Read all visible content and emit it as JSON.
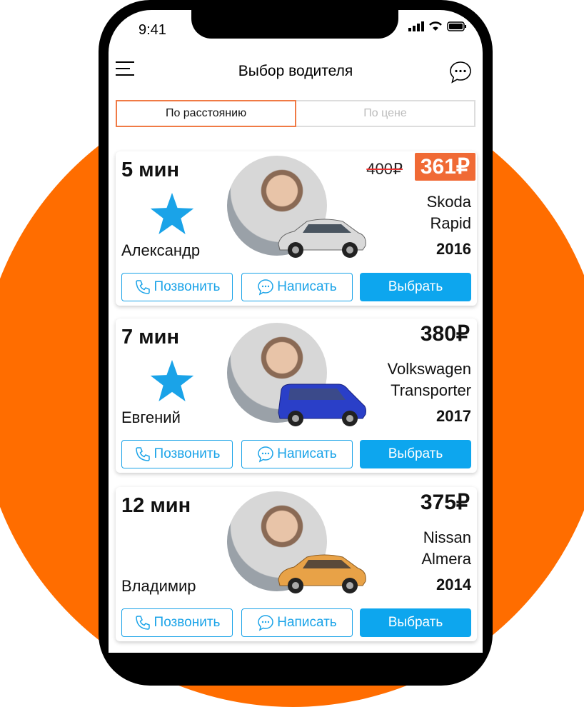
{
  "status": {
    "time": "9:41"
  },
  "header": {
    "title": "Выбор водителя"
  },
  "sort_tabs": [
    {
      "label": "По расстоянию",
      "active": true
    },
    {
      "label": "По цене",
      "active": false
    }
  ],
  "buttons": {
    "call": "Позвонить",
    "message": "Написать",
    "select": "Выбрать"
  },
  "drivers": [
    {
      "eta": "5 мин",
      "name": "Александр",
      "old_price": "400₽",
      "price": "361₽",
      "car_make": "Skoda",
      "car_model": "Rapid",
      "year": "2016",
      "rated": true,
      "car_color": "#d9d9d9"
    },
    {
      "eta": "7 мин",
      "name": "Евгений",
      "price": "380₽",
      "car_make": "Volkswagen",
      "car_model": "Transporter",
      "year": "2017",
      "rated": true,
      "car_color": "#2a3fc8"
    },
    {
      "eta": "12 мин",
      "name": "Владимир",
      "price": "375₽",
      "car_make": "Nissan",
      "car_model": "Almera",
      "year": "2014",
      "rated": false,
      "car_color": "#e8a247"
    }
  ],
  "colors": {
    "accent": "#ff6d00",
    "primary": "#0da6ee",
    "star": "#1aa3e8",
    "discount": "#f06a35"
  }
}
